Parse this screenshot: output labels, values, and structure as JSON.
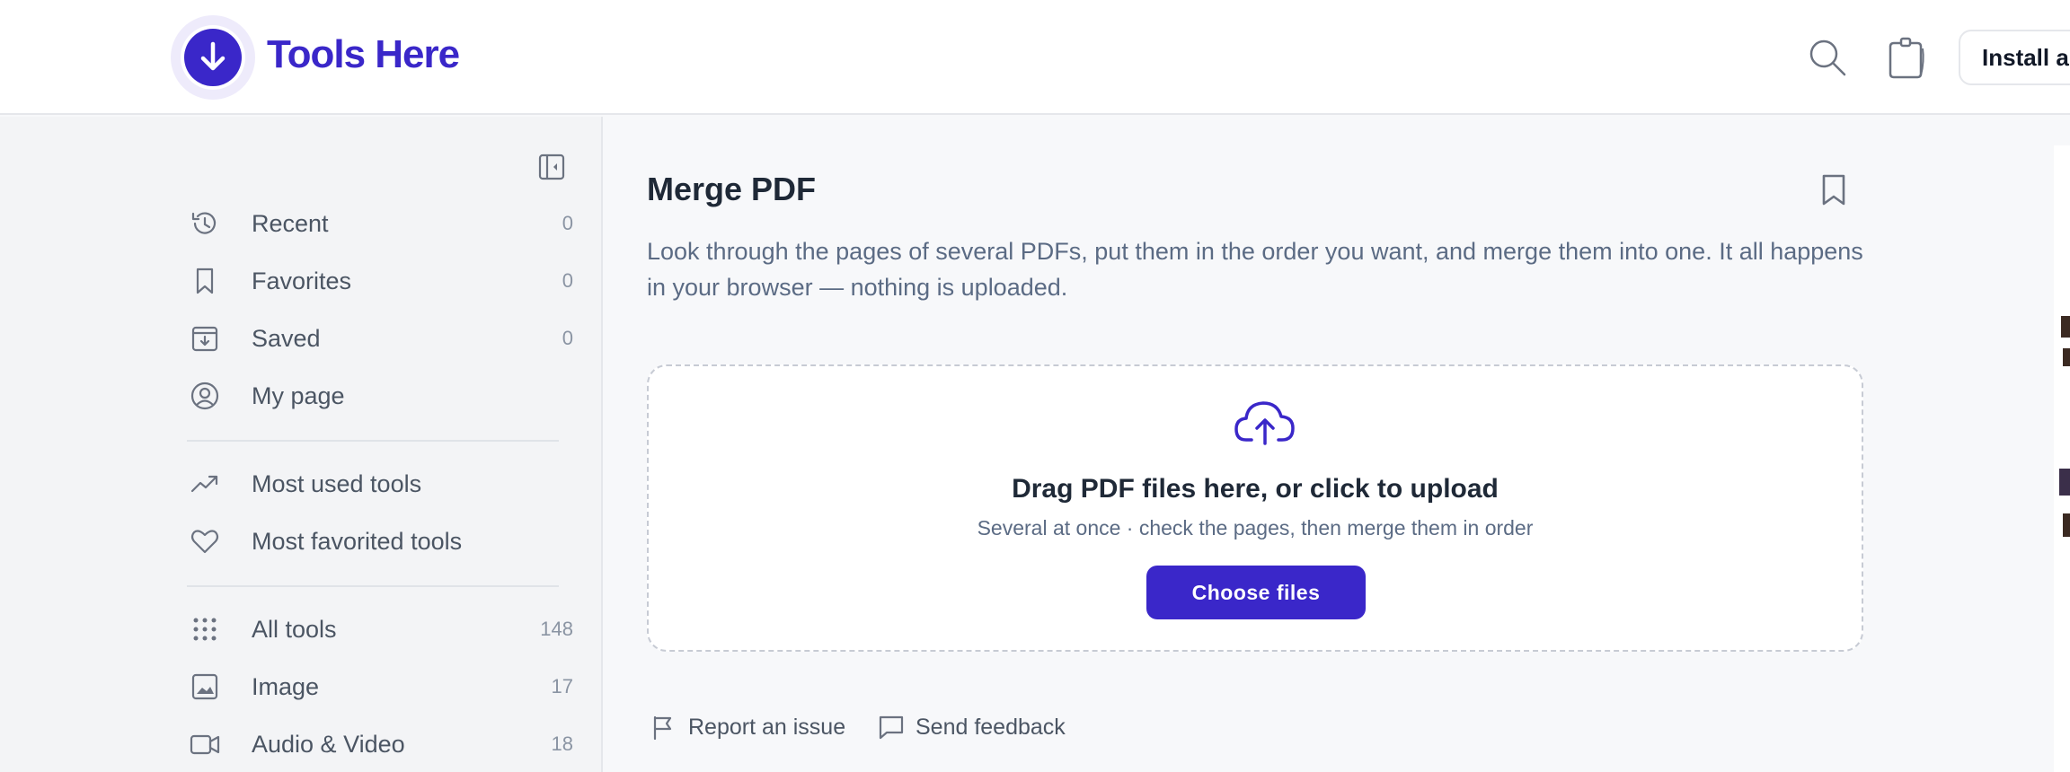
{
  "header": {
    "brand": "Tools Here",
    "install_label": "Install a",
    "icons": [
      "arrow-down-icon",
      "search-icon",
      "clipboard-icon"
    ],
    "accent": "#3a27c9"
  },
  "sidebar": {
    "items": [
      {
        "label": "Recent",
        "count": "0",
        "icon": "history-icon"
      },
      {
        "label": "Favorites",
        "count": "0",
        "icon": "bookmark-icon"
      },
      {
        "label": "Saved",
        "count": "0",
        "icon": "archive-icon"
      },
      {
        "label": "My page",
        "count": "",
        "icon": "user-circle-icon"
      }
    ],
    "items2": [
      {
        "label": "Most used tools",
        "icon": "trending-up-icon"
      },
      {
        "label": "Most favorited tools",
        "icon": "heart-icon"
      }
    ],
    "items3": [
      {
        "label": "All tools",
        "count": "148",
        "icon": "grid-dots-icon"
      },
      {
        "label": "Image",
        "count": "17",
        "icon": "image-icon"
      },
      {
        "label": "Audio & Video",
        "count": "18",
        "icon": "video-icon"
      }
    ]
  },
  "main": {
    "title": "Merge PDF",
    "description": "Look through the pages of several PDFs, put them in the order you want, and merge them into one. It all happens in your browser — nothing is uploaded.",
    "dropzone": {
      "title": "Drag PDF files here, or click to upload",
      "subtitle": "Several at once · check the pages, then merge them in order",
      "button": "Choose files"
    },
    "footer": {
      "report": "Report an issue",
      "feedback": "Send feedback"
    }
  }
}
